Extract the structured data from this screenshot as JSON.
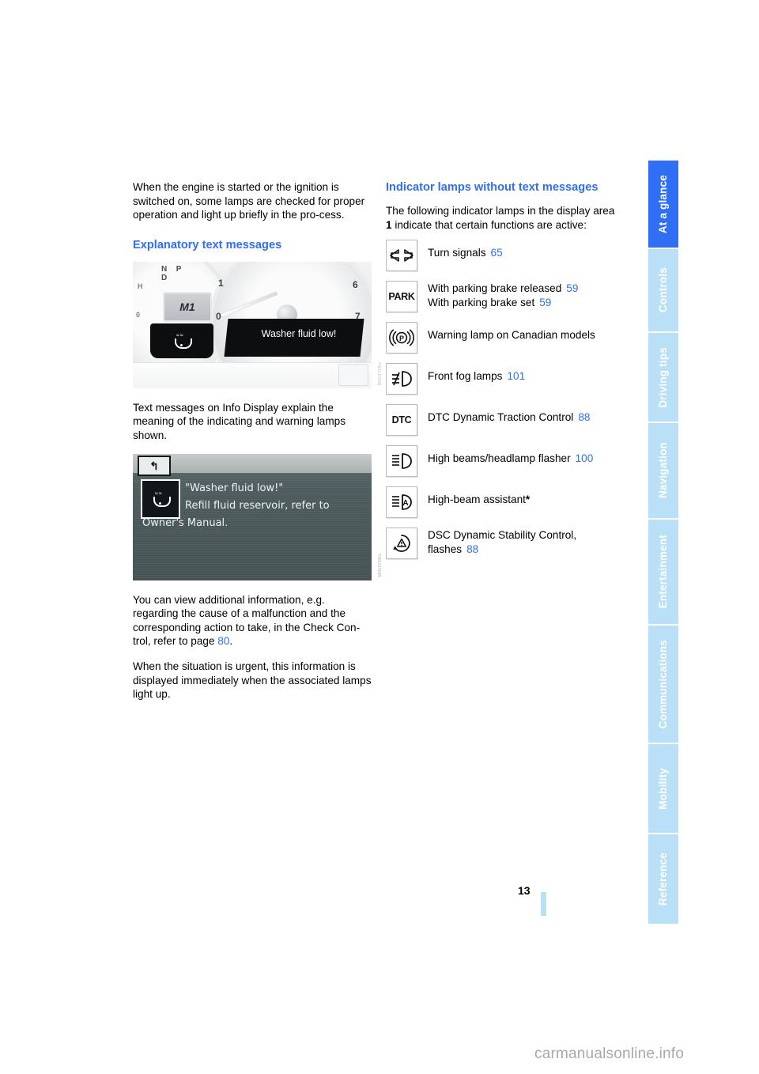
{
  "document": {
    "page_number": "13",
    "site_watermark": "carmanualsonline.info",
    "accent_color": "#2f6ef5",
    "tab_color": "#b9e0f7"
  },
  "tabs": [
    {
      "label": "At a glance",
      "active": true
    },
    {
      "label": "Controls",
      "active": false
    },
    {
      "label": "Driving tips",
      "active": false
    },
    {
      "label": "Navigation",
      "active": false
    },
    {
      "label": "Entertainment",
      "active": false
    },
    {
      "label": "Communications",
      "active": false
    },
    {
      "label": "Mobility",
      "active": false
    },
    {
      "label": "Reference",
      "active": false
    }
  ],
  "left_column": {
    "intro_paragraph": "When the engine is started or the ignition is switched on, some lamps are checked for proper operation and light up briefly in the pro-cess.",
    "section_heading": "Explanatory text messages",
    "figure_cluster": {
      "caption_watermark": "MH13754lo",
      "gear_labels": "N P\nD",
      "gear_display": "M1",
      "message": "Washer fluid low!",
      "tick_0": "0",
      "tick_1": "1",
      "tick_6": "6",
      "tick_7": "7",
      "small_left_1": "H",
      "small_left_2": "0",
      "warning_icon": "washer-fluid-icon"
    },
    "paragraph_after_cluster": "Text messages on Info Display explain the meaning of the indicating and warning lamps shown.",
    "figure_infodisplay": {
      "caption_watermark": "MH13756lo",
      "back_button": "back-arrow-icon",
      "message_icon": "washer-fluid-icon",
      "line1": "\"Washer fluid low!\"",
      "line2": "Refill fluid reservoir, refer to",
      "line3": "Owner's Manual."
    },
    "paragraph_check_control_a": "You can view additional information, e.g. regarding the cause of a malfunction and the corresponding action to take, in the Check Con-trol, refer to page ",
    "paragraph_check_control_ref": "80",
    "paragraph_check_control_b": ".",
    "paragraph_urgent": "When the situation is urgent, this information is displayed immediately when the associated lamps light up."
  },
  "right_column": {
    "section_heading": "Indicator lamps without text messages",
    "intro_a": "The following indicator lamps in the display area ",
    "intro_bold": "1",
    "intro_b": " indicate that certain functions are active:",
    "lamps": [
      {
        "icon": "turn-signal-arrows-icon",
        "label": "Turn signals",
        "page": "65",
        "sub_label": "",
        "sub_page": ""
      },
      {
        "icon": "park-text-icon",
        "label": "With parking brake released",
        "page": "59",
        "sub_label": "With parking brake set",
        "sub_page": "59"
      },
      {
        "icon": "parking-brake-p-circle-icon",
        "label": "Warning lamp on Canadian models",
        "page": "",
        "sub_label": "",
        "sub_page": ""
      },
      {
        "icon": "front-fog-lamp-icon",
        "label": "Front fog lamps",
        "page": "101",
        "sub_label": "",
        "sub_page": ""
      },
      {
        "icon": "dtc-text-icon",
        "label": "DTC Dynamic Traction Control",
        "page": "88",
        "sub_label": "",
        "sub_page": ""
      },
      {
        "icon": "high-beam-icon",
        "label": "High beams/headlamp flasher",
        "page": "100",
        "sub_label": "",
        "sub_page": ""
      },
      {
        "icon": "high-beam-assistant-icon",
        "label": "High-beam assistant",
        "page": "",
        "asterisk": "*",
        "sub_label": "",
        "sub_page": ""
      },
      {
        "icon": "dsc-triangle-icon",
        "label": "DSC Dynamic Stability Control,",
        "page": "",
        "sub_label": "flashes",
        "sub_page": "88"
      }
    ]
  }
}
